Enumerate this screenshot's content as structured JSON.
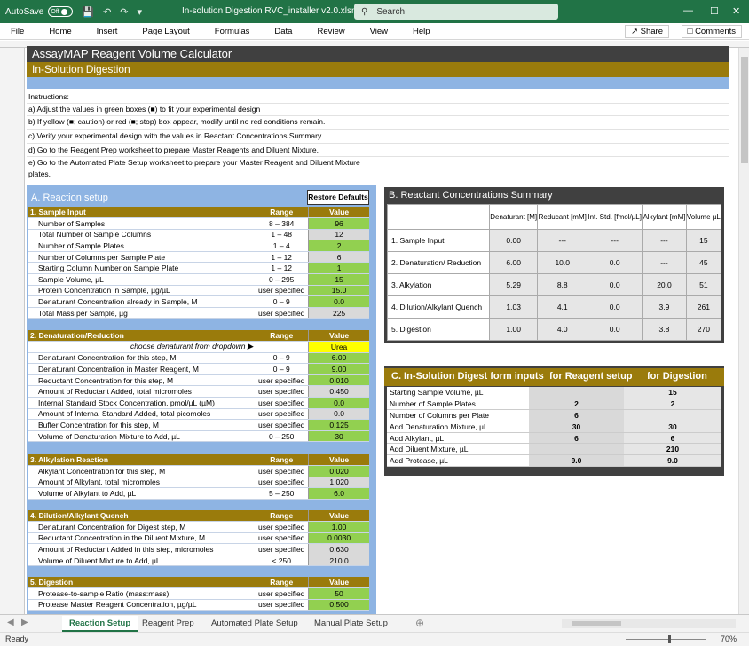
{
  "titlebar": {
    "autosave": "AutoSave",
    "autosave_state": "Off",
    "filename": "In-solution Digestion RVC_installer v2.0.xlsm",
    "search_placeholder": "Search"
  },
  "menu": [
    "File",
    "Home",
    "Insert",
    "Page Layout",
    "Formulas",
    "Data",
    "Review",
    "View",
    "Help"
  ],
  "share": "Share",
  "comments": "Comments",
  "header": {
    "title": "AssayMAP Reagent Volume Calculator",
    "subtitle": "In-Solution Digestion"
  },
  "instructions": [
    "Instructions:",
    "a) Adjust the values in green boxes (■) to fit your experimental design",
    "b) If yellow (■; caution) or red (■; stop) box appear, modify until no red conditions remain.",
    "c) Verify your experimental design with the values in Reactant Concentrations Summary.",
    "d) Go to the Reagent Prep worksheet to prepare Master Reagents and Diluent Mixture.",
    "e) Go to the Automated Plate Setup worksheet to prepare your Master Reagent and Diluent Mixture",
    "plates."
  ],
  "sectionA": {
    "title": "A. Reaction setup",
    "restore_label": "Restore Defaults",
    "range_label": "Range",
    "value_label": "Value",
    "groups": [
      {
        "title": "1. Sample Input",
        "rows": [
          {
            "label": "Number of Samples",
            "range": "8 – 384",
            "value": "96",
            "style": "green"
          },
          {
            "label": "Total Number of Sample Columns",
            "range": "1 – 48",
            "value": "12",
            "style": "gray"
          },
          {
            "label": "Number of Sample Plates",
            "range": "1 – 4",
            "value": "2",
            "style": "green"
          },
          {
            "label": "Number of Columns per Sample Plate",
            "range": "1 – 12",
            "value": "6",
            "style": "gray"
          },
          {
            "label": "Starting Column Number on Sample Plate",
            "range": "1 – 12",
            "value": "1",
            "style": "green"
          },
          {
            "label": "Sample Volume, µL",
            "range": "0 – 295",
            "value": "15",
            "style": "green"
          },
          {
            "label": "Protein Concentration in Sample, µg/µL",
            "range": "user specified",
            "value": "15.0",
            "style": "green"
          },
          {
            "label": "Denaturant Concentration already in Sample, M",
            "range": "0 – 9",
            "value": "0.0",
            "style": "green"
          },
          {
            "label": "Total Mass per Sample, µg",
            "range": "user specified",
            "value": "225",
            "style": "gray"
          }
        ]
      },
      {
        "title": "2. Denaturation/Reduction",
        "rows": [
          {
            "label": "choose denaturant from dropdown ▶",
            "range": "",
            "value": "Urea",
            "style": "yellowsel",
            "italic": true
          },
          {
            "label": "Denaturant Concentration for this step, M",
            "range": "0 – 9",
            "value": "6.00",
            "style": "green"
          },
          {
            "label": "Denaturant Concentration in Master Reagent,  M",
            "range": "0 – 9",
            "value": "9.00",
            "style": "green"
          },
          {
            "label": "Reductant Concentration for this step, M",
            "range": "user specified",
            "value": "0.010",
            "style": "green"
          },
          {
            "label": "Amount of Reductant Added, total micromoles",
            "range": "user specified",
            "value": "0.450",
            "style": "gray"
          },
          {
            "label": "Internal Standard Stock Concentration, pmol/µL (µM)",
            "range": "user specified",
            "value": "0.0",
            "style": "green"
          },
          {
            "label": "Amount of Internal Standard Added, total picomoles",
            "range": "user specified",
            "value": "0.0",
            "style": "gray"
          },
          {
            "label": "Buffer Concentration for this step, M",
            "range": "user specified",
            "value": "0.125",
            "style": "green"
          },
          {
            "label": "Volume of Denaturation Mixture to Add, µL",
            "range": "0 – 250",
            "value": "30",
            "style": "green"
          }
        ]
      },
      {
        "title": "3. Alkylation Reaction",
        "rows": [
          {
            "label": "Alkylant Concentration for this step, M",
            "range": "user specified",
            "value": "0.020",
            "style": "green"
          },
          {
            "label": "Amount of Alkylant, total micromoles",
            "range": "user specified",
            "value": "1.020",
            "style": "gray"
          },
          {
            "label": "Volume of Alkylant to Add, µL",
            "range": "5 – 250",
            "value": "6.0",
            "style": "green"
          }
        ]
      },
      {
        "title": "4. Dilution/Alkylant Quench",
        "rows": [
          {
            "label": "Denaturant Concentration for Digest step, M",
            "range": "user specified",
            "value": "1.00",
            "style": "green"
          },
          {
            "label": "Reductant Concentration in the Diluent Mixture, M",
            "range": "user specified",
            "value": "0.0030",
            "style": "green"
          },
          {
            "label": "Amount of Reductant Added in this step, micromoles",
            "range": "user specified",
            "value": "0.630",
            "style": "gray"
          },
          {
            "label": "Volume of Diluent Mixture to Add, µL",
            "range": "< 250",
            "value": "210.0",
            "style": "gray"
          }
        ]
      },
      {
        "title": "5. Digestion",
        "rows": [
          {
            "label": "Protease-to-sample Ratio (mass:mass)",
            "range": "user specified",
            "value": "50",
            "style": "green"
          },
          {
            "label": "Protease Master Reagent Concentration, µg/µL",
            "range": "user specified",
            "value": "0.500",
            "style": "green"
          }
        ]
      }
    ]
  },
  "sectionB": {
    "title": "B. Reactant Concentrations Summary",
    "columns": [
      "Denaturant [M]",
      "Reducant [mM]",
      "Int. Std. [fmol/µL]",
      "Alkylant [mM]",
      "Volume µL"
    ],
    "rows": [
      {
        "label": "1. Sample Input",
        "values": [
          "0.00",
          "---",
          "---",
          "---",
          "15"
        ]
      },
      {
        "label": "2. Denaturation/ Reduction",
        "values": [
          "6.00",
          "10.0",
          "0.0",
          "---",
          "45"
        ]
      },
      {
        "label": "3. Alkylation",
        "values": [
          "5.29",
          "8.8",
          "0.0",
          "20.0",
          "51"
        ]
      },
      {
        "label": "4. Dilution/Alkylant Quench",
        "values": [
          "1.03",
          "4.1",
          "0.0",
          "3.9",
          "261"
        ]
      },
      {
        "label": "5. Digestion",
        "values": [
          "1.00",
          "4.0",
          "0.0",
          "3.8",
          "270"
        ]
      }
    ]
  },
  "sectionC": {
    "title": "C. In-Solution Digest form inputs",
    "col_reagent": "for Reagent setup",
    "col_digestion": "for Digestion",
    "rows": [
      {
        "label": "Starting Sample Volume, µL",
        "reagent": "",
        "digestion": "15"
      },
      {
        "label": "Number of Sample Plates",
        "reagent": "2",
        "digestion": "2"
      },
      {
        "label": "Number of Columns per Plate",
        "reagent": "6",
        "digestion": ""
      },
      {
        "label": "Add Denaturation Mixture, µL",
        "reagent": "30",
        "digestion": "30"
      },
      {
        "label": "Add Alkylant, µL",
        "reagent": "6",
        "digestion": "6"
      },
      {
        "label": "Add Diluent Mixture, µL",
        "reagent": "",
        "digestion": "210"
      },
      {
        "label": "Add Protease, µL",
        "reagent": "9.0",
        "digestion": "9.0"
      }
    ]
  },
  "sheet_tabs": [
    "Reaction Setup",
    "Reagent Prep",
    "Automated Plate Setup",
    "Manual Plate Setup"
  ],
  "status": {
    "ready": "Ready",
    "zoom": "70%"
  },
  "colors": {
    "excel_green": "#217346",
    "gold": "#9a7b0c",
    "dark": "#404040",
    "blue": "#8eb4e3",
    "cell_green": "#92d050"
  }
}
